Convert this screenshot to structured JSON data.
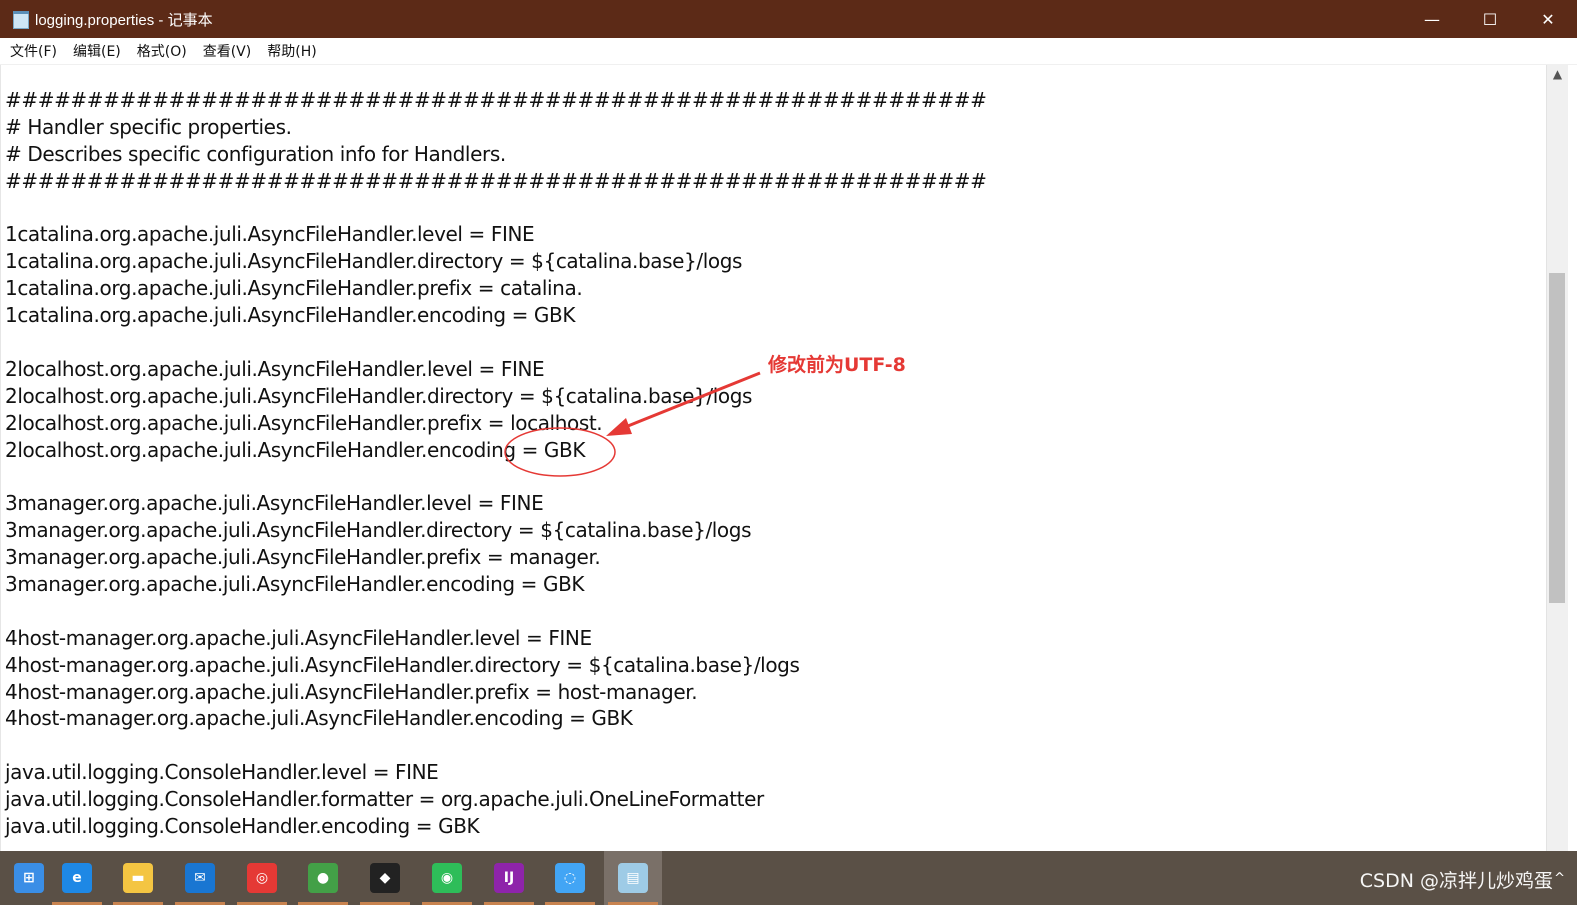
{
  "window": {
    "title": "logging.properties - 记事本",
    "controls": {
      "minimize": "—",
      "maximize": "☐",
      "close": "✕"
    }
  },
  "menu": {
    "items": [
      "文件(F)",
      "编辑(E)",
      "格式(O)",
      "查看(V)",
      "帮助(H)"
    ]
  },
  "editor": {
    "lines": [
      "############################################################",
      "# Handler specific properties.",
      "# Describes specific configuration info for Handlers.",
      "############################################################",
      "",
      "1catalina.org.apache.juli.AsyncFileHandler.level = FINE",
      "1catalina.org.apache.juli.AsyncFileHandler.directory = ${catalina.base}/logs",
      "1catalina.org.apache.juli.AsyncFileHandler.prefix = catalina.",
      "1catalina.org.apache.juli.AsyncFileHandler.encoding = GBK",
      "",
      "2localhost.org.apache.juli.AsyncFileHandler.level = FINE",
      "2localhost.org.apache.juli.AsyncFileHandler.directory = ${catalina.base}/logs",
      "2localhost.org.apache.juli.AsyncFileHandler.prefix = localhost.",
      "2localhost.org.apache.juli.AsyncFileHandler.encoding = GBK",
      "",
      "3manager.org.apache.juli.AsyncFileHandler.level = FINE",
      "3manager.org.apache.juli.AsyncFileHandler.directory = ${catalina.base}/logs",
      "3manager.org.apache.juli.AsyncFileHandler.prefix = manager.",
      "3manager.org.apache.juli.AsyncFileHandler.encoding = GBK",
      "",
      "4host-manager.org.apache.juli.AsyncFileHandler.level = FINE",
      "4host-manager.org.apache.juli.AsyncFileHandler.directory = ${catalina.base}/logs",
      "4host-manager.org.apache.juli.AsyncFileHandler.prefix = host-manager.",
      "4host-manager.org.apache.juli.AsyncFileHandler.encoding = GBK",
      "",
      "java.util.logging.ConsoleHandler.level = FINE",
      "java.util.logging.ConsoleHandler.formatter = org.apache.juli.OneLineFormatter",
      "java.util.logging.ConsoleHandler.encoding = GBK"
    ]
  },
  "annotation": {
    "text": "修改前为UTF-8",
    "color": "#e53935"
  },
  "taskbar": {
    "apps": [
      {
        "name": "start",
        "icon": "windows-logo-icon",
        "glyph": "⊞",
        "color": "#3a8ee6"
      },
      {
        "name": "edge",
        "icon": "edge-icon",
        "glyph": "e",
        "color": "#1e88e5"
      },
      {
        "name": "explorer",
        "icon": "folder-icon",
        "glyph": "▬",
        "color": "#f4c542"
      },
      {
        "name": "mail",
        "icon": "mail-icon",
        "glyph": "✉",
        "color": "#1976d2"
      },
      {
        "name": "netease-music",
        "icon": "music-icon",
        "glyph": "◎",
        "color": "#e53935"
      },
      {
        "name": "chrome",
        "icon": "chrome-icon",
        "glyph": "●",
        "color": "#43a047"
      },
      {
        "name": "qq",
        "icon": "qq-penguin-icon",
        "glyph": "◆",
        "color": "#222222"
      },
      {
        "name": "wechat",
        "icon": "wechat-icon",
        "glyph": "◉",
        "color": "#2ebd59"
      },
      {
        "name": "intellij",
        "icon": "intellij-icon",
        "glyph": "IJ",
        "color": "#8e24aa"
      },
      {
        "name": "browser",
        "icon": "browser-icon",
        "glyph": "◌",
        "color": "#42a5f5"
      },
      {
        "name": "notepad",
        "icon": "notepad-icon",
        "glyph": "▤",
        "color": "#9ecbe6"
      }
    ],
    "tray_text": "^"
  },
  "watermark": "CSDN @凉拌儿炒鸡蛋"
}
